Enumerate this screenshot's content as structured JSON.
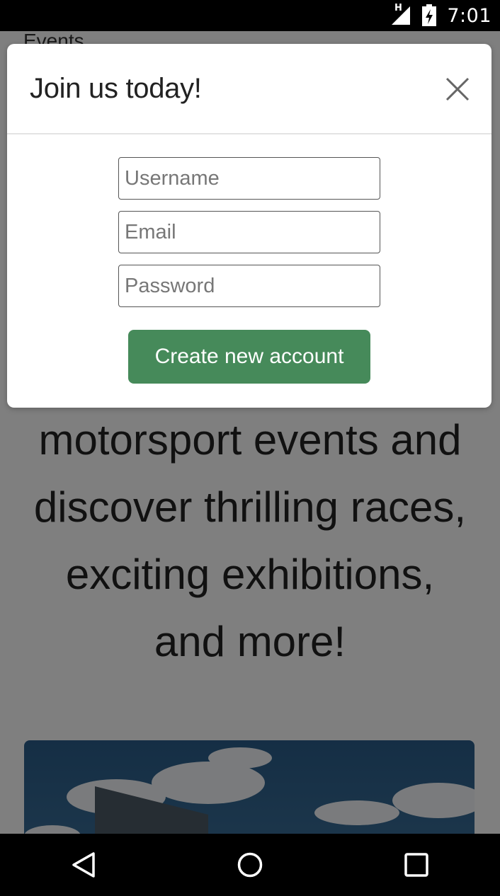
{
  "status_bar": {
    "network_type": "H",
    "time": "7:01",
    "icons": [
      "signal-icon",
      "battery-charging-icon"
    ]
  },
  "page": {
    "section_label": "Events",
    "hero_lines": [
      "motorsport events and",
      "discover thrilling races,",
      "exciting exhibitions,",
      "and more!"
    ]
  },
  "modal": {
    "title": "Join us today!",
    "close_icon": "close-icon",
    "username_placeholder": "Username",
    "email_placeholder": "Email",
    "password_placeholder": "Password",
    "submit_label": "Create new account"
  },
  "colors": {
    "accent": "#468a5a",
    "overlay": "rgba(0,0,0,0.5)"
  },
  "nav_bar": {
    "icons": [
      "back-icon",
      "home-icon",
      "recents-icon"
    ]
  }
}
